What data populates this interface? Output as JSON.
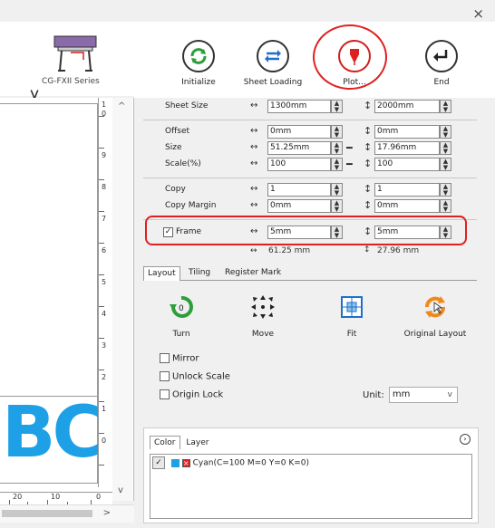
{
  "window": {
    "close_glyph": "×"
  },
  "device": {
    "label": "CG-FXII Series"
  },
  "left_doc": {
    "partial_letter": "y",
    "canvas_text": "BC"
  },
  "rulers": {
    "vertical": [
      "1",
      "0",
      "9",
      "8",
      "7",
      "6",
      "5",
      "4",
      "3",
      "2",
      "1",
      "0"
    ],
    "vertical_zero": "0",
    "horizontal": [
      "20",
      "10",
      "0"
    ]
  },
  "toolbar": {
    "initialize": "Initialize",
    "sheet_loading": "Sheet Loading",
    "plot": "Plot...",
    "end": "End"
  },
  "params": {
    "sheet_size": {
      "label": "Sheet Size",
      "w": "1300mm",
      "h": "2000mm"
    },
    "offset": {
      "label": "Offset",
      "w": "0mm",
      "h": "0mm"
    },
    "size": {
      "label": "Size",
      "w": "51.25mm",
      "h": "17.96mm"
    },
    "scale": {
      "label": "Scale(%)",
      "w": "100",
      "h": "100"
    },
    "copy": {
      "label": "Copy",
      "w": "1",
      "h": "1"
    },
    "copy_margin": {
      "label": "Copy Margin",
      "w": "0mm",
      "h": "0mm"
    },
    "frame": {
      "label": "Frame",
      "checked": true,
      "w": "5mm",
      "h": "5mm"
    },
    "totals": {
      "w": "61.25 mm",
      "h": "27.96 mm"
    }
  },
  "tabs": [
    "Layout",
    "Tiling",
    "Register Mark"
  ],
  "layout": {
    "turn": "Turn",
    "turn_value": "0",
    "move": "Move",
    "fit": "Fit",
    "original_layout": "Original Layout",
    "mirror": "Mirror",
    "unlock_scale": "Unlock Scale",
    "origin_lock": "Origin Lock",
    "unit_label": "Unit:",
    "unit_value": "mm"
  },
  "color_panel": {
    "tabs": [
      "Color",
      "Layer"
    ],
    "items": [
      {
        "label": "Cyan(C=100 M=0 Y=0 K=0)",
        "swatch": "#1ea0e6"
      }
    ]
  },
  "colors": {
    "highlight": "#e02020",
    "accent": "#1ea0e6",
    "green": "#2e9e3a",
    "orange": "#ef8a1a"
  }
}
